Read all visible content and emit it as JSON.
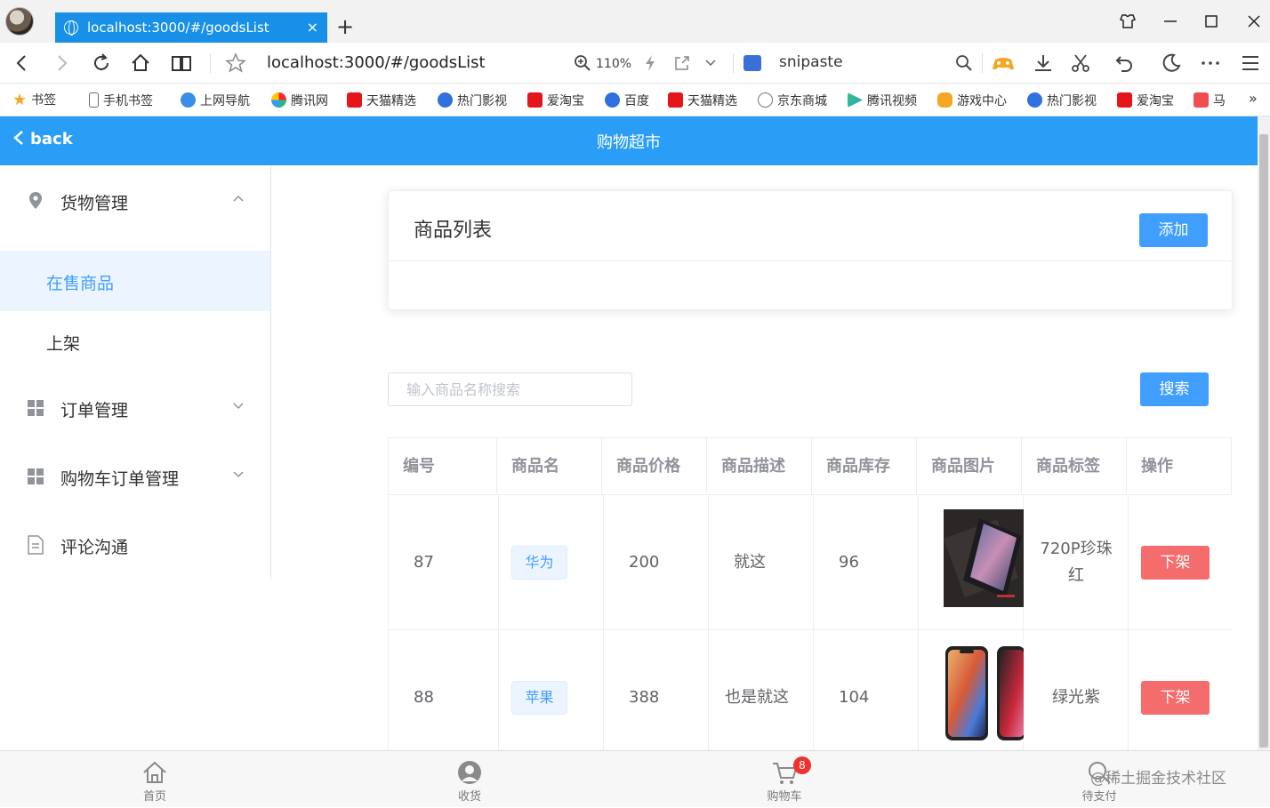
{
  "browser": {
    "tab_title": "localhost:3000/#/goodsList",
    "tab_close": "×",
    "new_tab": "+",
    "url": "localhost:3000/#/goodsList",
    "zoom": "110%",
    "search_engine": "snipaste",
    "bookmarks": [
      "书签",
      "手机书签",
      "上网导航",
      "腾讯网",
      "天猫精选",
      "热门影视",
      "爱淘宝",
      "百度",
      "天猫精选",
      "京东商城",
      "腾讯视频",
      "游戏中心",
      "热门影视",
      "爱淘宝",
      "马"
    ],
    "bookmark_more": "»"
  },
  "header": {
    "back_label": "back",
    "title": "购物超市"
  },
  "sidebar": {
    "goods_menu": "货物管理",
    "goods_items": [
      "在售商品",
      "上架"
    ],
    "order_menu": "订单管理",
    "cart_order_menu": "购物车订单管理",
    "comment_menu": "评论沟通"
  },
  "card": {
    "title": "商品列表",
    "add_label": "添加"
  },
  "search": {
    "placeholder": "输入商品名称搜索",
    "button_label": "搜索"
  },
  "table": {
    "columns": [
      "编号",
      "商品名",
      "商品价格",
      "商品描述",
      "商品库存",
      "商品图片",
      "商品标签",
      "操作"
    ],
    "rows": [
      {
        "id": "87",
        "name": "华为",
        "price": "200",
        "desc": "就这",
        "stock": "96",
        "label": "720P珍珠红",
        "action": "下架"
      },
      {
        "id": "88",
        "name": "苹果",
        "price": "388",
        "desc": "也是就这",
        "stock": "104",
        "label": "绿光紫",
        "action": "下架"
      }
    ]
  },
  "bottom_nav": {
    "home": "首页",
    "receive": "收货",
    "cart": "购物车",
    "cart_badge": "8",
    "pending": "待支付",
    "watermark": "@稀土掘金技术社区"
  },
  "colors": {
    "primary": "#409eff",
    "header": "#2a9ef7",
    "danger": "#f56c6c",
    "tab": "#1890e8"
  }
}
